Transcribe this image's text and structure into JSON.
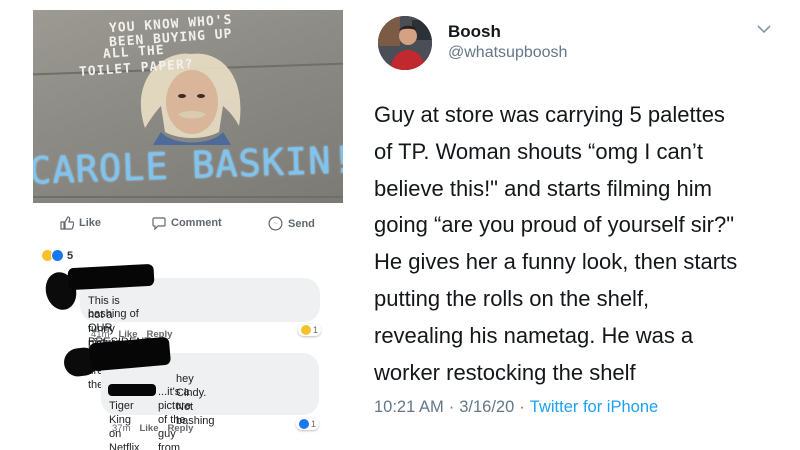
{
  "facebook": {
    "photo": {
      "chalk_lines": [
        "YOU KNOW  WHO'S",
        "BEEN  BUYING UP",
        "ALL           THE",
        "TOILET     PAPER?"
      ],
      "chalk_name": "CAROLE BASKIN!"
    },
    "actions": [
      {
        "label": "Like",
        "icon": "thumbs-up-icon"
      },
      {
        "label": "Comment",
        "icon": "comment-bubble-icon"
      },
      {
        "label": "Send",
        "icon": "messenger-icon"
      }
    ],
    "reaction_count": "5",
    "comments": [
      {
        "lines": [
          "This is not a funny picture.  So tired of the",
          "bashing of OUR PRESIDENT"
        ],
        "time": "41m",
        "like": "Like",
        "reply": "Reply",
        "reaction_count": "1",
        "reaction_color": "#f7c12d"
      },
      {
        "lines": [
          "hey Cindy.  Not bashing",
          "...it's a picture of the guy from",
          "Tiger King on Netflix"
        ],
        "time": "37m",
        "like": "Like",
        "reply": "Reply",
        "reaction_count": "1",
        "reaction_color": "#1877f2"
      }
    ]
  },
  "tweet": {
    "name": "Boosh",
    "handle": "@whatsupboosh",
    "body_lines": [
      "Guy at store was carrying 5 palettes",
      "of TP. Woman shouts “omg I can’t",
      "believe this!\" and starts filming him",
      "going “are you proud of yourself sir?\"",
      "He gives her a funny look, then starts",
      "putting the rolls on the shelf,",
      "revealing his nametag. He was a",
      "worker restocking the shelf"
    ],
    "time": "10:21 AM",
    "separator": "·",
    "date": "3/16/20",
    "source": "Twitter for iPhone",
    "source_color": "#1da1f2"
  }
}
